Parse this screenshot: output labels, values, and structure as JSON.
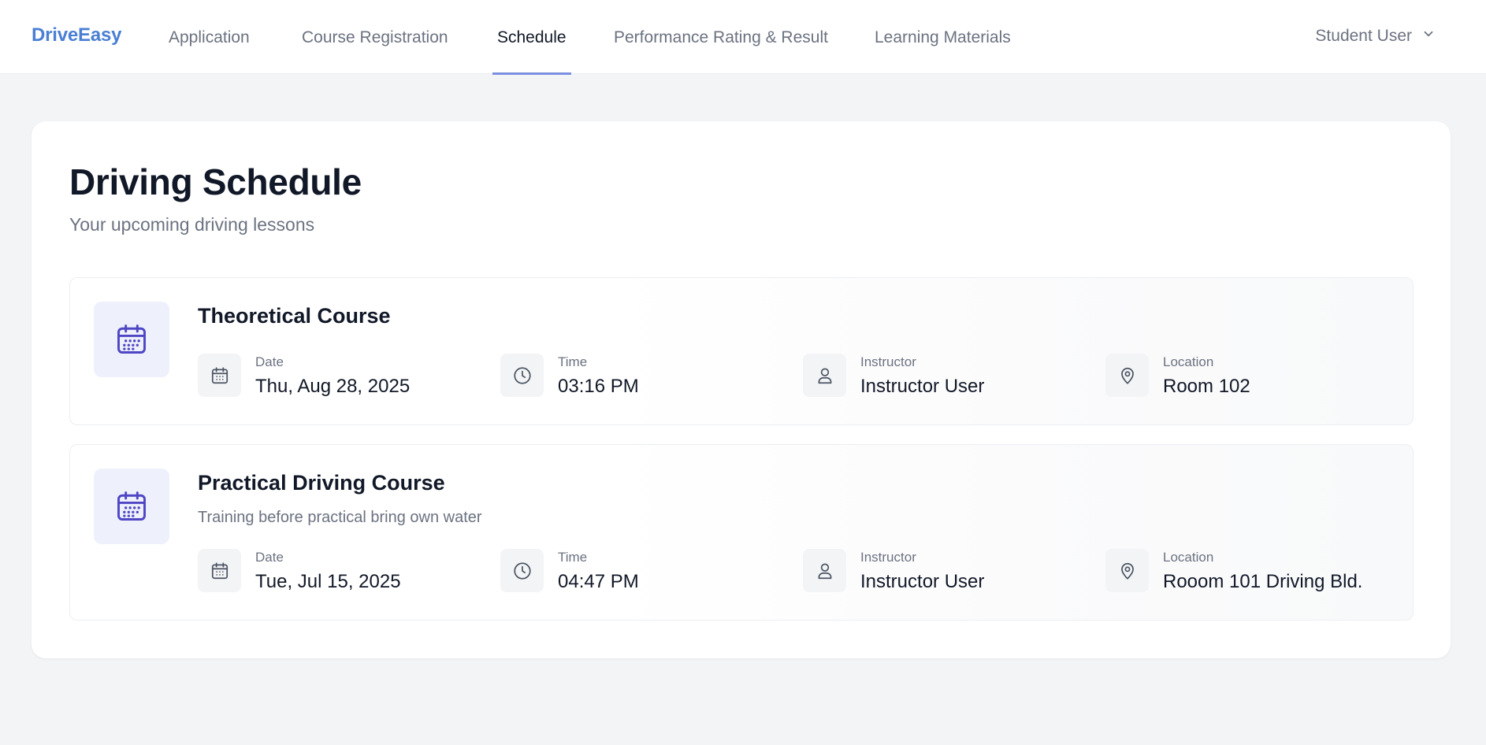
{
  "app": {
    "brand": "DriveEasy"
  },
  "nav": {
    "tabs": [
      {
        "label": "Application",
        "active": false
      },
      {
        "label": "Course Registration",
        "active": false
      },
      {
        "label": "Schedule",
        "active": true
      },
      {
        "label": "Performance Rating & Result",
        "active": false
      },
      {
        "label": "Learning Materials",
        "active": false
      }
    ],
    "user_menu": {
      "label": "Student User",
      "icon": "chevron-down-icon"
    }
  },
  "page": {
    "title": "Driving Schedule",
    "subtitle": "Your upcoming driving lessons"
  },
  "lessons": [
    {
      "title": "Theoretical Course",
      "description": "",
      "icon": "calendar-icon",
      "fields": {
        "date": {
          "label": "Date",
          "value": "Thu, Aug 28, 2025",
          "icon": "calendar-icon"
        },
        "time": {
          "label": "Time",
          "value": "03:16 PM",
          "icon": "clock-icon"
        },
        "instructor": {
          "label": "Instructor",
          "value": "Instructor User",
          "icon": "user-icon"
        },
        "location": {
          "label": "Location",
          "value": "Room 102",
          "icon": "map-pin-icon"
        }
      }
    },
    {
      "title": "Practical Driving Course",
      "description": "Training before practical bring own water",
      "icon": "calendar-icon",
      "fields": {
        "date": {
          "label": "Date",
          "value": "Tue, Jul 15, 2025",
          "icon": "calendar-icon"
        },
        "time": {
          "label": "Time",
          "value": "04:47 PM",
          "icon": "clock-icon"
        },
        "instructor": {
          "label": "Instructor",
          "value": "Instructor User",
          "icon": "user-icon"
        },
        "location": {
          "label": "Location",
          "value": "Rooom 101 Driving Bld.",
          "icon": "map-pin-icon"
        }
      }
    }
  ],
  "colors": {
    "brand": "#4a7fd4",
    "active_tab_underline": "#7b8fe0",
    "lesson_icon_bg": "#eef1fb",
    "lesson_icon": "#4f46c5",
    "page_bg": "#f3f4f6"
  }
}
